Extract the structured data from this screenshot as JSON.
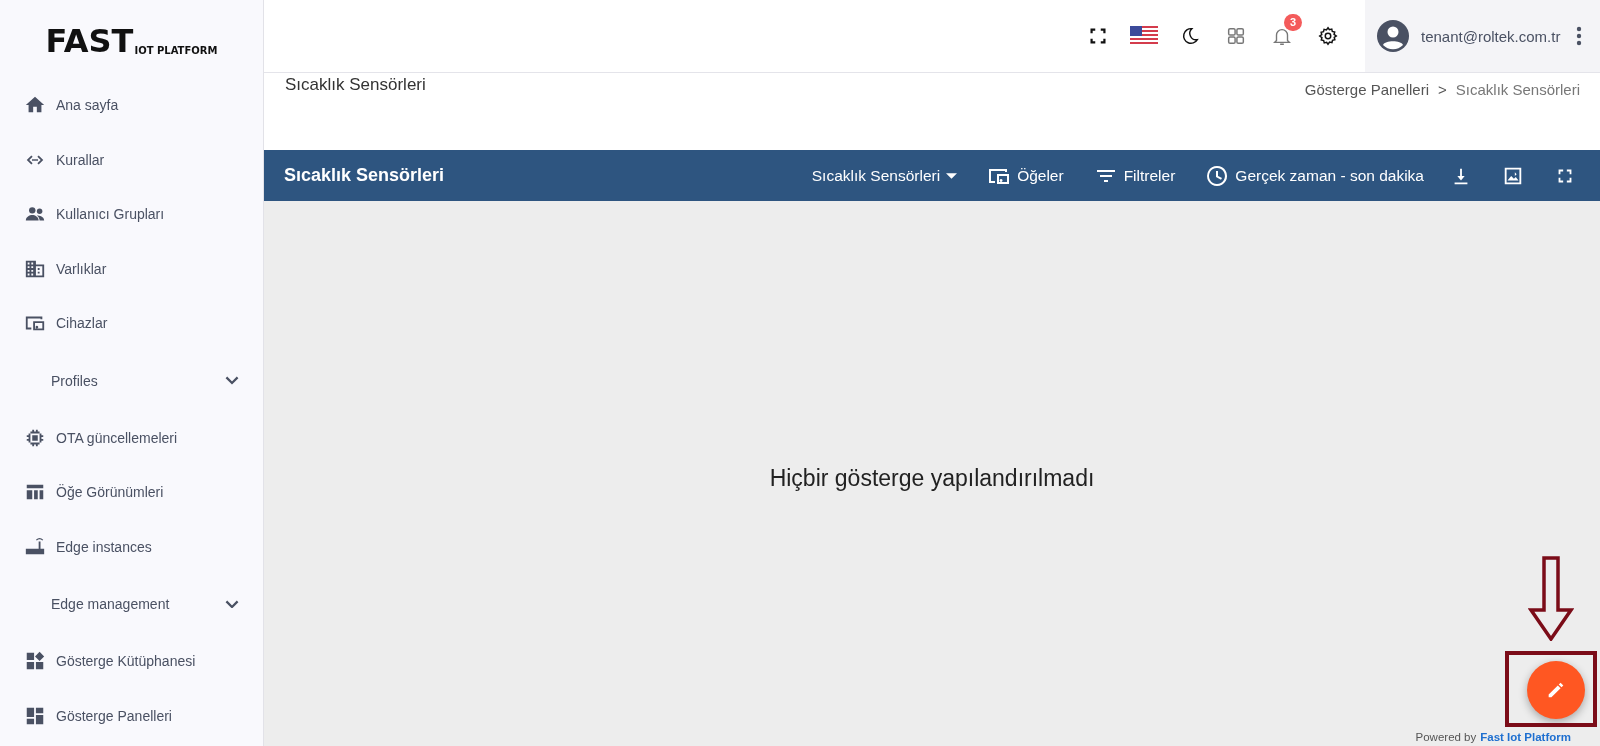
{
  "logo": {
    "main": "FAST",
    "sub": "IOT PLATFORM"
  },
  "sidebar": {
    "items": [
      {
        "kind": "link",
        "label": "Ana sayfa",
        "selected": false
      },
      {
        "kind": "link",
        "label": "Kurallar",
        "selected": false
      },
      {
        "kind": "link",
        "label": "Kullanıcı Grupları",
        "selected": false
      },
      {
        "kind": "link",
        "label": "Varlıklar",
        "selected": false
      },
      {
        "kind": "link",
        "label": "Cihazlar",
        "selected": false
      },
      {
        "kind": "section",
        "label": "Profiles",
        "expanded": false
      },
      {
        "kind": "link",
        "label": "OTA güncellemeleri",
        "selected": false
      },
      {
        "kind": "link",
        "label": "Öğe Görünümleri",
        "selected": false
      },
      {
        "kind": "link",
        "label": "Edge instances",
        "selected": false
      },
      {
        "kind": "section",
        "label": "Edge management",
        "expanded": false
      },
      {
        "kind": "link",
        "label": "Gösterge Kütüphanesi",
        "selected": false
      },
      {
        "kind": "link",
        "label": "Gösterge Panelleri",
        "selected": false
      }
    ]
  },
  "topbar": {
    "notification_count": "3",
    "user": "tenant@roltek.com.tr"
  },
  "page_header": {
    "title": "Sıcaklık Sensörleri",
    "breadcrumb": [
      "Gösterge Panelleri",
      "Sıcaklık Sensörleri"
    ],
    "separator": ">"
  },
  "dashboard_toolbar": {
    "title": "Sıcaklık Sensörleri",
    "state_select": "Sıcaklık Sensörleri",
    "entities": "Öğeler",
    "filters": "Filtreler",
    "timewindow": "Gerçek zaman - son dakika"
  },
  "empty_message": "Hiçbir gösterge yapılandırılmadı",
  "footer": {
    "prefix": "Powered by",
    "link": "Fast Iot Platform"
  }
}
